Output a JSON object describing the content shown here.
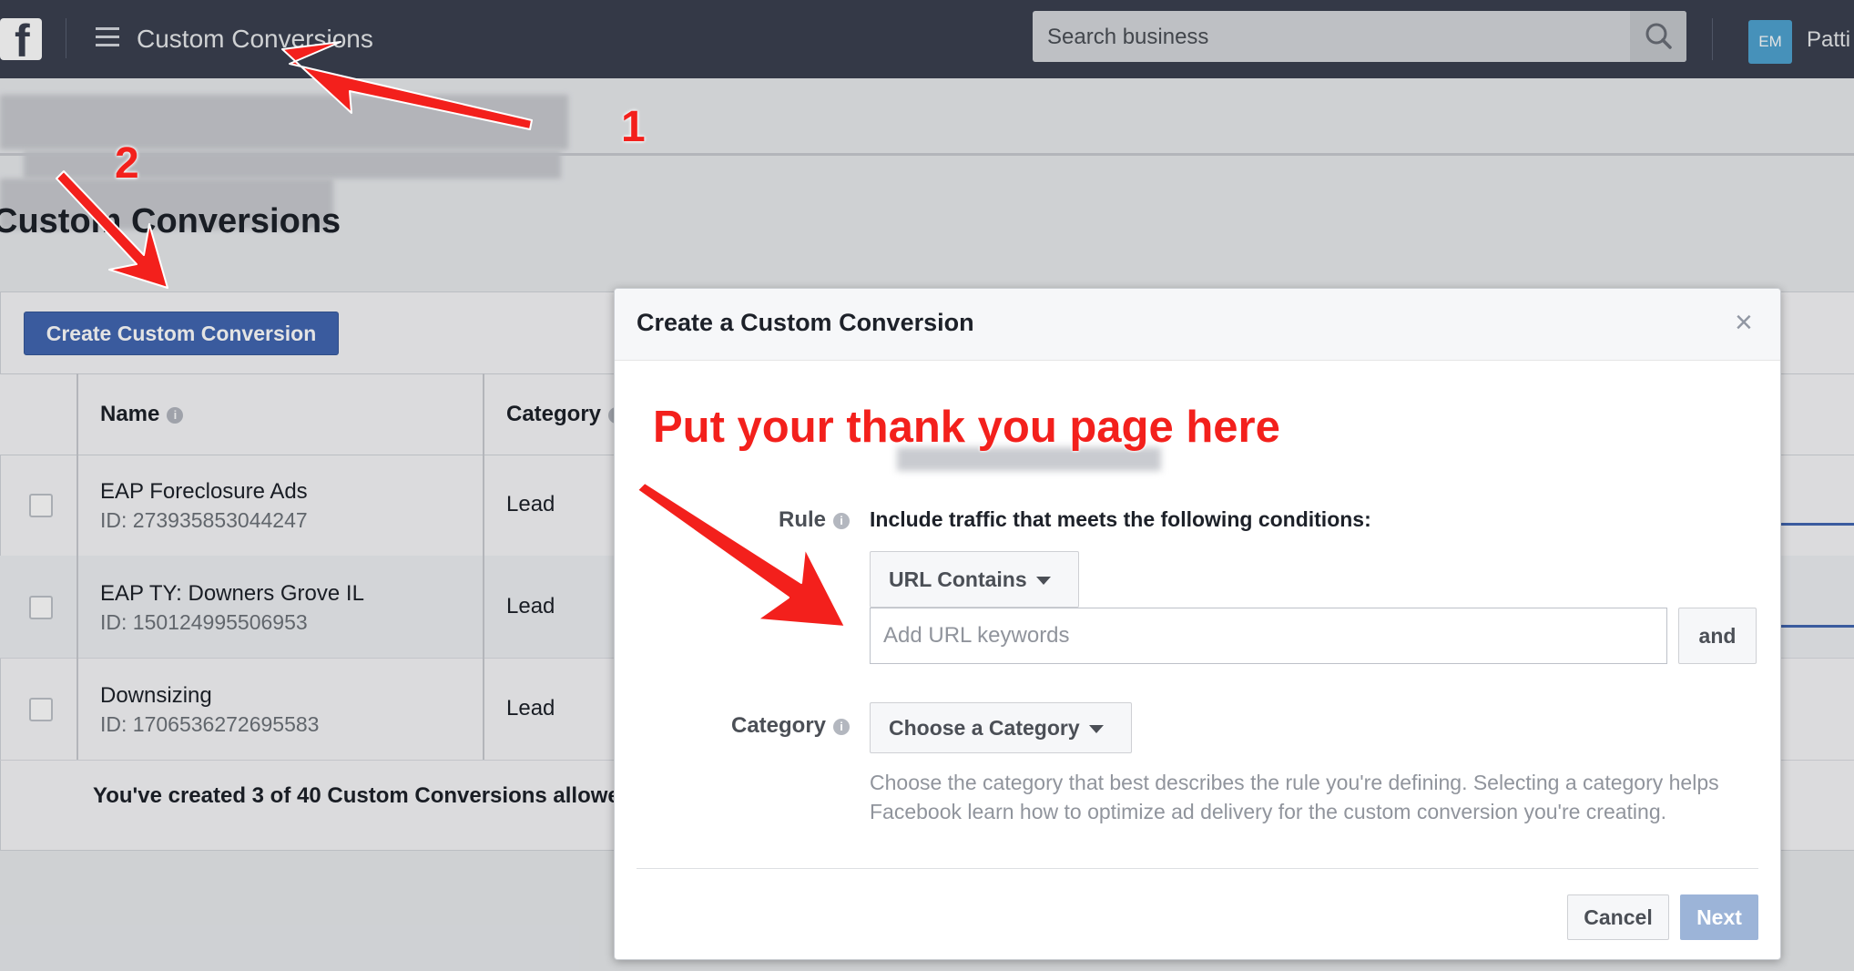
{
  "topbar": {
    "logo_letter": "f",
    "app_title": "Custom Conversions",
    "search_placeholder": "Search business",
    "avatar_initials": "EM",
    "user_name": "Patti"
  },
  "page": {
    "heading": "Custom Conversions",
    "create_button": "Create Custom Conversion",
    "columns": {
      "name": "Name",
      "category": "Category"
    },
    "rows": [
      {
        "name": "EAP Foreclosure Ads",
        "id": "ID: 273935853044247",
        "category": "Lead"
      },
      {
        "name": "EAP TY: Downers Grove IL",
        "id": "ID: 150124995506953",
        "category": "Lead"
      },
      {
        "name": "Downsizing",
        "id": "ID: 1706536272695583",
        "category": "Lead"
      }
    ],
    "footer_note": "You've created 3 of 40 Custom Conversions allowe"
  },
  "modal": {
    "title": "Create a Custom Conversion",
    "close_glyph": "×",
    "rule_label": "Rule",
    "rule_text": "Include traffic that meets the following conditions:",
    "url_dropdown": "URL Contains",
    "url_placeholder": "Add URL keywords",
    "and_button": "and",
    "category_label": "Category",
    "category_dropdown": "Choose a Category",
    "help_text": "Choose the category that best describes the rule you're defining. Selecting a category helps Facebook learn how to optimize ad delivery for the custom conversion you're creating.",
    "cancel_button": "Cancel",
    "next_button": "Next"
  },
  "annotations": {
    "step_1": "1",
    "step_2": "2",
    "callout": "Put your thank you page here",
    "color": "#f3201c"
  },
  "icons": {
    "menu": "hamburger-icon",
    "search": "search-icon",
    "info": "info-icon",
    "close": "close-icon",
    "caret": "caret-down-icon"
  },
  "colors": {
    "topbar": "#3b4150",
    "primary_button": "#4267b2",
    "next_disabled": "#9cb4d8"
  }
}
